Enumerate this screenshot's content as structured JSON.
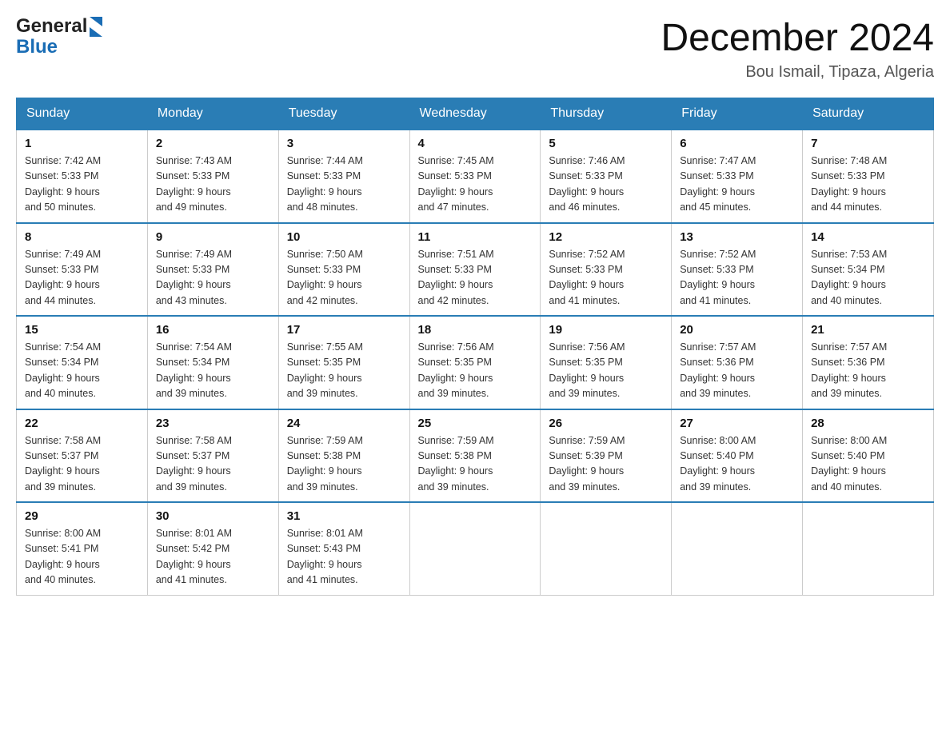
{
  "header": {
    "logo_general": "General",
    "logo_blue": "Blue",
    "month_title": "December 2024",
    "location": "Bou Ismail, Tipaza, Algeria"
  },
  "days_of_week": [
    "Sunday",
    "Monday",
    "Tuesday",
    "Wednesday",
    "Thursday",
    "Friday",
    "Saturday"
  ],
  "weeks": [
    [
      {
        "day": "1",
        "info": "Sunrise: 7:42 AM\nSunset: 5:33 PM\nDaylight: 9 hours\nand 50 minutes."
      },
      {
        "day": "2",
        "info": "Sunrise: 7:43 AM\nSunset: 5:33 PM\nDaylight: 9 hours\nand 49 minutes."
      },
      {
        "day": "3",
        "info": "Sunrise: 7:44 AM\nSunset: 5:33 PM\nDaylight: 9 hours\nand 48 minutes."
      },
      {
        "day": "4",
        "info": "Sunrise: 7:45 AM\nSunset: 5:33 PM\nDaylight: 9 hours\nand 47 minutes."
      },
      {
        "day": "5",
        "info": "Sunrise: 7:46 AM\nSunset: 5:33 PM\nDaylight: 9 hours\nand 46 minutes."
      },
      {
        "day": "6",
        "info": "Sunrise: 7:47 AM\nSunset: 5:33 PM\nDaylight: 9 hours\nand 45 minutes."
      },
      {
        "day": "7",
        "info": "Sunrise: 7:48 AM\nSunset: 5:33 PM\nDaylight: 9 hours\nand 44 minutes."
      }
    ],
    [
      {
        "day": "8",
        "info": "Sunrise: 7:49 AM\nSunset: 5:33 PM\nDaylight: 9 hours\nand 44 minutes."
      },
      {
        "day": "9",
        "info": "Sunrise: 7:49 AM\nSunset: 5:33 PM\nDaylight: 9 hours\nand 43 minutes."
      },
      {
        "day": "10",
        "info": "Sunrise: 7:50 AM\nSunset: 5:33 PM\nDaylight: 9 hours\nand 42 minutes."
      },
      {
        "day": "11",
        "info": "Sunrise: 7:51 AM\nSunset: 5:33 PM\nDaylight: 9 hours\nand 42 minutes."
      },
      {
        "day": "12",
        "info": "Sunrise: 7:52 AM\nSunset: 5:33 PM\nDaylight: 9 hours\nand 41 minutes."
      },
      {
        "day": "13",
        "info": "Sunrise: 7:52 AM\nSunset: 5:33 PM\nDaylight: 9 hours\nand 41 minutes."
      },
      {
        "day": "14",
        "info": "Sunrise: 7:53 AM\nSunset: 5:34 PM\nDaylight: 9 hours\nand 40 minutes."
      }
    ],
    [
      {
        "day": "15",
        "info": "Sunrise: 7:54 AM\nSunset: 5:34 PM\nDaylight: 9 hours\nand 40 minutes."
      },
      {
        "day": "16",
        "info": "Sunrise: 7:54 AM\nSunset: 5:34 PM\nDaylight: 9 hours\nand 39 minutes."
      },
      {
        "day": "17",
        "info": "Sunrise: 7:55 AM\nSunset: 5:35 PM\nDaylight: 9 hours\nand 39 minutes."
      },
      {
        "day": "18",
        "info": "Sunrise: 7:56 AM\nSunset: 5:35 PM\nDaylight: 9 hours\nand 39 minutes."
      },
      {
        "day": "19",
        "info": "Sunrise: 7:56 AM\nSunset: 5:35 PM\nDaylight: 9 hours\nand 39 minutes."
      },
      {
        "day": "20",
        "info": "Sunrise: 7:57 AM\nSunset: 5:36 PM\nDaylight: 9 hours\nand 39 minutes."
      },
      {
        "day": "21",
        "info": "Sunrise: 7:57 AM\nSunset: 5:36 PM\nDaylight: 9 hours\nand 39 minutes."
      }
    ],
    [
      {
        "day": "22",
        "info": "Sunrise: 7:58 AM\nSunset: 5:37 PM\nDaylight: 9 hours\nand 39 minutes."
      },
      {
        "day": "23",
        "info": "Sunrise: 7:58 AM\nSunset: 5:37 PM\nDaylight: 9 hours\nand 39 minutes."
      },
      {
        "day": "24",
        "info": "Sunrise: 7:59 AM\nSunset: 5:38 PM\nDaylight: 9 hours\nand 39 minutes."
      },
      {
        "day": "25",
        "info": "Sunrise: 7:59 AM\nSunset: 5:38 PM\nDaylight: 9 hours\nand 39 minutes."
      },
      {
        "day": "26",
        "info": "Sunrise: 7:59 AM\nSunset: 5:39 PM\nDaylight: 9 hours\nand 39 minutes."
      },
      {
        "day": "27",
        "info": "Sunrise: 8:00 AM\nSunset: 5:40 PM\nDaylight: 9 hours\nand 39 minutes."
      },
      {
        "day": "28",
        "info": "Sunrise: 8:00 AM\nSunset: 5:40 PM\nDaylight: 9 hours\nand 40 minutes."
      }
    ],
    [
      {
        "day": "29",
        "info": "Sunrise: 8:00 AM\nSunset: 5:41 PM\nDaylight: 9 hours\nand 40 minutes."
      },
      {
        "day": "30",
        "info": "Sunrise: 8:01 AM\nSunset: 5:42 PM\nDaylight: 9 hours\nand 41 minutes."
      },
      {
        "day": "31",
        "info": "Sunrise: 8:01 AM\nSunset: 5:43 PM\nDaylight: 9 hours\nand 41 minutes."
      },
      {
        "day": "",
        "info": ""
      },
      {
        "day": "",
        "info": ""
      },
      {
        "day": "",
        "info": ""
      },
      {
        "day": "",
        "info": ""
      }
    ]
  ]
}
